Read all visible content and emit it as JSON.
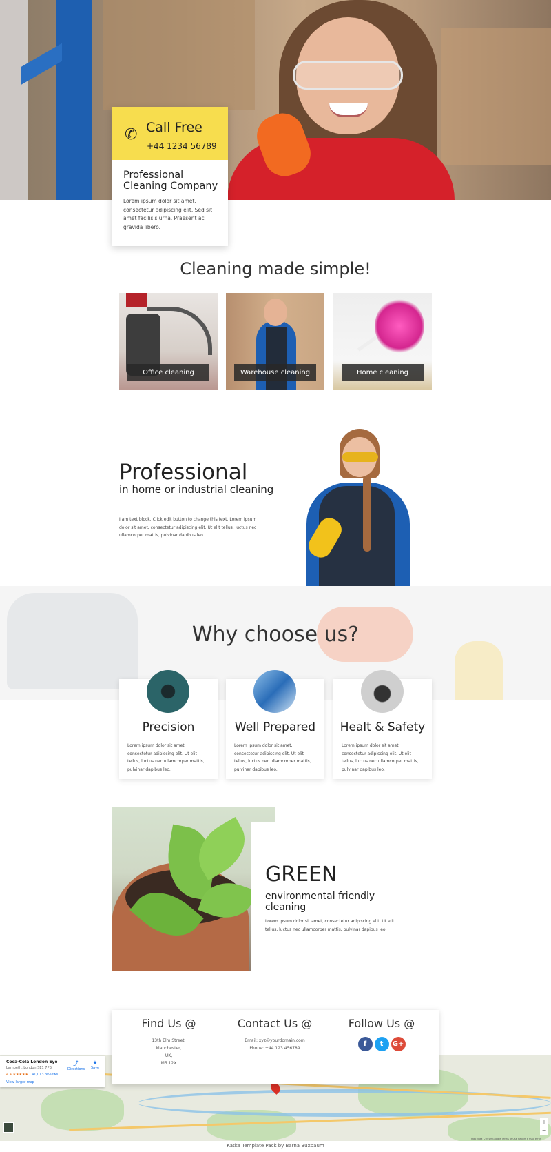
{
  "hero": {
    "call_title": "Call Free",
    "call_phone": "+44 1234 56789",
    "company": "Professional Cleaning Company",
    "description": "Lorem ipsum dolor sit amet, consectetur adipiscing elit. Sed sit amet facilisis urna. Praesent ac gravida libero.",
    "phone_icon": "phone-icon",
    "accent_color": "#f7dd4e"
  },
  "services": {
    "title": "Cleaning made simple!",
    "items": [
      {
        "label": "Office cleaning"
      },
      {
        "label": "Warehouse cleaning"
      },
      {
        "label": "Home cleaning"
      }
    ]
  },
  "professional": {
    "title": "Professional",
    "subtitle": "in home or industrial cleaning",
    "description": "I am text block. Click edit button to change this text. Lorem ipsum dolor sit amet, consectetur adipiscing elit. Ut elit tellus, luctus nec ullamcorper mattis, pulvinar dapibus leo."
  },
  "why": {
    "title": "Why choose us?",
    "features": [
      {
        "title": "Precision",
        "description": "Lorem ipsum dolor sit amet, consectetur adipiscing elit. Ut elit tellus, luctus nec ullamcorper mattis, pulvinar dapibus leo."
      },
      {
        "title": "Well Prepared",
        "description": "Lorem ipsum dolor sit amet, consectetur adipiscing elit. Ut elit tellus, luctus nec ullamcorper mattis, pulvinar dapibus leo."
      },
      {
        "title": "Healt & Safety",
        "description": "Lorem ipsum dolor sit amet, consectetur adipiscing elit. Ut elit tellus, luctus nec ullamcorper mattis, pulvinar dapibus leo."
      }
    ]
  },
  "green": {
    "title": "GREEN",
    "subtitle": "environmental friendly cleaning",
    "description": "Lorem ipsum dolor sit amet, consectetur adipiscing elit. Ut elit tellus, luctus nec ullamcorper mattis, pulvinar dapibus leo."
  },
  "contact": {
    "find_title": "Find Us @",
    "address": [
      "13th Elm Street,",
      "Manchester,",
      "UK,",
      "M5 12X"
    ],
    "contact_title": "Contact Us @",
    "email": "Email: xyz@yourdomain.com",
    "phone": "Phone: +44 123 456789",
    "follow_title": "Follow Us @",
    "social": [
      {
        "name": "facebook-icon",
        "glyph": "f",
        "color": "#3b5998"
      },
      {
        "name": "twitter-icon",
        "glyph": "t",
        "color": "#1da1f2"
      },
      {
        "name": "google-plus-icon",
        "glyph": "G+",
        "color": "#dd4b39"
      }
    ]
  },
  "map": {
    "place_name": "Coca-Cola London Eye",
    "address": "Lambeth, London SE1 7PB",
    "rating": "4.4 ★★★★★",
    "reviews": "41,013 reviews",
    "larger_map": "View larger map",
    "directions_label": "Directions",
    "save_label": "Save",
    "zoom_in": "+",
    "zoom_out": "−",
    "attribution": "Map data ©2019 Google  Terms of Use  Report a map error"
  },
  "footer": {
    "credit": "Katka Template Pack by Barna Buxbaum"
  }
}
